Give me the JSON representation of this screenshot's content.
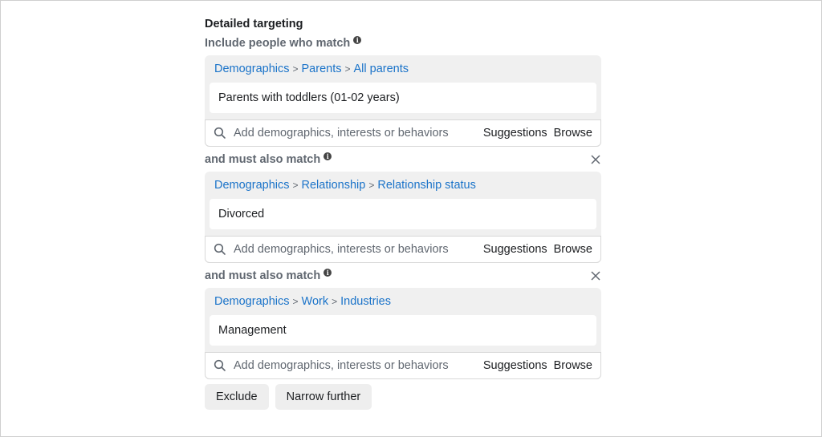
{
  "title": "Detailed targeting",
  "include_label": "Include people who match",
  "groups": [
    {
      "breadcrumb": [
        "Demographics",
        "Parents",
        "All parents"
      ],
      "selected": "Parents with toddlers (01-02 years)",
      "search_placeholder": "Add demographics, interests or behaviors",
      "suggestions": "Suggestions",
      "browse": "Browse"
    },
    {
      "label": "and must also match",
      "breadcrumb": [
        "Demographics",
        "Relationship",
        "Relationship status"
      ],
      "selected": "Divorced",
      "search_placeholder": "Add demographics, interests or behaviors",
      "suggestions": "Suggestions",
      "browse": "Browse"
    },
    {
      "label": "and must also match",
      "breadcrumb": [
        "Demographics",
        "Work",
        "Industries"
      ],
      "selected": "Management",
      "search_placeholder": "Add demographics, interests or behaviors",
      "suggestions": "Suggestions",
      "browse": "Browse"
    }
  ],
  "separator": ">",
  "buttons": {
    "exclude": "Exclude",
    "narrow": "Narrow further"
  },
  "colors": {
    "link": "#1a73c9",
    "muted": "#606770",
    "panel": "#f0f0f0"
  }
}
